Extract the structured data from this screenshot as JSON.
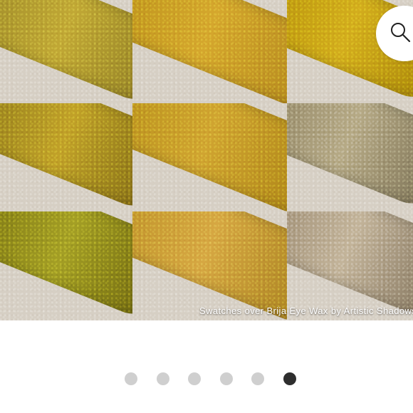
{
  "gallery": {
    "swatches": [
      {
        "colors": [
          "#9c8a2e",
          "#c0a83a",
          "#8f7e2a"
        ]
      },
      {
        "colors": [
          "#b78f1f",
          "#d3a733",
          "#b08622"
        ]
      },
      {
        "colors": [
          "#b59212",
          "#d1ad24",
          "#a7850f"
        ]
      },
      {
        "colors": [
          "#8f7a20",
          "#bfa12e",
          "#7f6a1a"
        ]
      },
      {
        "colors": [
          "#b38d1f",
          "#cea436",
          "#a9821a"
        ]
      },
      {
        "colors": [
          "#8f8466",
          "#b5aa88",
          "#7c7257"
        ]
      },
      {
        "colors": [
          "#7a7418",
          "#a39f2a",
          "#6d6614"
        ]
      },
      {
        "colors": [
          "#b98f2a",
          "#d4a747",
          "#a47e23"
        ]
      },
      {
        "colors": [
          "#9a8a72",
          "#c2b49b",
          "#857761"
        ]
      }
    ],
    "caption": "Swatches over Brija Eye Wax by Artistic Shadows I"
  },
  "zoom": {
    "icon": "search-icon"
  },
  "pagination": {
    "total": 6,
    "active_index": 5,
    "colors": {
      "inactive": "#cfcfcf",
      "active": "#2e2e2e"
    }
  }
}
